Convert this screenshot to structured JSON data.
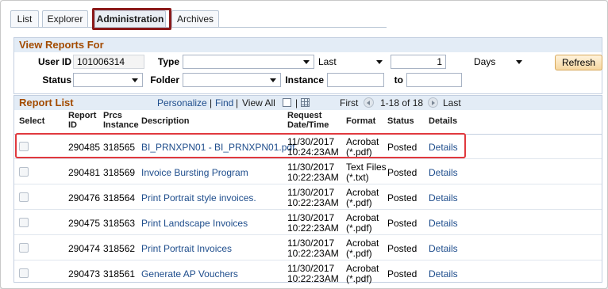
{
  "tabs": [
    "List",
    "Explorer",
    "Administration",
    "Archives"
  ],
  "view_reports": {
    "title": "View Reports For",
    "user_id_label": "User ID",
    "user_id_value": "101006314",
    "type_label": "Type",
    "type_value": "",
    "last_select": "Last",
    "last_number": "1",
    "days_select": "Days",
    "refresh_label": "Refresh",
    "status_label": "Status",
    "status_value": "",
    "folder_label": "Folder",
    "folder_value": "",
    "instance_label": "Instance",
    "instance_value": "",
    "to_label": "to",
    "to_value": ""
  },
  "report_list": {
    "title": "Report List",
    "personalize": "Personalize",
    "find": "Find",
    "view_all": "View All",
    "first": "First",
    "range": "1-18 of 18",
    "last": "Last",
    "columns": {
      "select": "Select",
      "report_id_1": "Report",
      "report_id_2": "ID",
      "prcs_1": "Prcs",
      "prcs_2": "Instance",
      "description": "Description",
      "request_1": "Request",
      "request_2": "Date/Time",
      "format": "Format",
      "status": "Status",
      "details": "Details"
    },
    "rows": [
      {
        "report_id": "290485",
        "instance": "318565",
        "description": "BI_PRNXPN01 - BI_PRNXPN01.pdf",
        "date": "11/30/2017",
        "time": "10:24:23AM",
        "format_1": "Acrobat",
        "format_2": "(*.pdf)",
        "status": "Posted",
        "details": "Details"
      },
      {
        "report_id": "290481",
        "instance": "318569",
        "description": "Invoice Bursting Program",
        "date": "11/30/2017",
        "time": "10:22:23AM",
        "format_1": "Text Files",
        "format_2": "(*.txt)",
        "status": "Posted",
        "details": "Details"
      },
      {
        "report_id": "290476",
        "instance": "318564",
        "description": "Print Portrait style invoices.",
        "date": "11/30/2017",
        "time": "10:22:23AM",
        "format_1": "Acrobat",
        "format_2": "(*.pdf)",
        "status": "Posted",
        "details": "Details"
      },
      {
        "report_id": "290475",
        "instance": "318563",
        "description": "Print Landscape Invoices",
        "date": "11/30/2017",
        "time": "10:22:23AM",
        "format_1": "Acrobat",
        "format_2": "(*.pdf)",
        "status": "Posted",
        "details": "Details"
      },
      {
        "report_id": "290474",
        "instance": "318562",
        "description": "Print Portrait Invoices",
        "date": "11/30/2017",
        "time": "10:22:23AM",
        "format_1": "Acrobat",
        "format_2": "(*.pdf)",
        "status": "Posted",
        "details": "Details"
      },
      {
        "report_id": "290473",
        "instance": "318561",
        "description": "Generate AP Vouchers",
        "date": "11/30/2017",
        "time": "10:22:23AM",
        "format_1": "Acrobat",
        "format_2": "(*.pdf)",
        "status": "Posted",
        "details": "Details"
      }
    ]
  },
  "colors": {
    "section_title": "#a34b00",
    "link": "#1e4d8c",
    "tab_highlight": "#8b1a1a",
    "row_highlight": "#e0393e"
  }
}
